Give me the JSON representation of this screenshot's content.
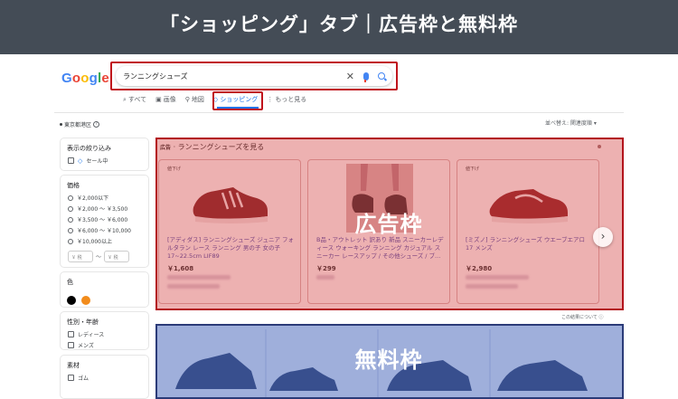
{
  "banner": {
    "title": "「ショッピング」タブ｜広告枠と無料枠"
  },
  "google": {
    "logo": [
      "G",
      "o",
      "o",
      "g",
      "l",
      "e"
    ]
  },
  "search": {
    "query": "ランニングシューズ",
    "clear_icon": "close-icon",
    "mic_icon": "mic-icon",
    "search_icon": "search-icon"
  },
  "tabs": [
    {
      "label": "すべて",
      "icon": "search-icon"
    },
    {
      "label": "画像",
      "icon": "image-icon"
    },
    {
      "label": "地図",
      "icon": "map-pin-icon"
    },
    {
      "label": "ショッピング",
      "icon": "tag-icon",
      "active": true
    },
    {
      "label": "もっと見る",
      "icon": "more-icon"
    }
  ],
  "location": {
    "text": "東京都港区"
  },
  "sort": {
    "label": "並べ替え: 関連度順"
  },
  "filters": {
    "refine": {
      "heading": "表示の絞り込み",
      "option": "セール中"
    },
    "price": {
      "heading": "価格",
      "options": [
        "￥2,000以下",
        "￥2,000 ～ ￥3,500",
        "￥3,500 ～ ￥6,000",
        "￥6,000 ～ ￥10,000",
        "￥10,000以上"
      ],
      "min_placeholder": "￥ 税",
      "max_placeholder": "￥ 税",
      "separator": "～"
    },
    "color": {
      "heading": "色",
      "swatches": [
        "#000000",
        "#f28c1c"
      ]
    },
    "gender": {
      "heading": "性別・年齢",
      "options": [
        "レディース",
        "メンズ"
      ]
    },
    "material": {
      "heading": "素材",
      "options": [
        "ゴム"
      ]
    }
  },
  "ads": {
    "header_label": "広告",
    "header_text": "· ランニングシューズを見る",
    "overlay_label": "広告枠",
    "products": [
      {
        "badge": "値下げ",
        "title": "[アディダス] ランニングシューズ ジュニア フォルタラン レース ランニング 男の子 女の子 17~22.5cm LIF89",
        "price": "￥1,608"
      },
      {
        "badge": "",
        "title": "B品・アウトレット 訳あり 新品 スニーカーレディース ウォーキング ランニング カジュアル スニーカー レースアップ / その他シューズ / ブ...",
        "price": "￥299"
      },
      {
        "badge": "値下げ",
        "title": "[ミズノ] ランニングシューズ ウエーブエアロ 17 メンズ",
        "price": "￥2,980"
      }
    ],
    "about": "この結果について ⓘ"
  },
  "free": {
    "overlay_label": "無料枠"
  },
  "colors": {
    "ad_red": "#b3141c",
    "free_blue": "#2b3b78",
    "banner_bg": "#444c56",
    "link_blue": "#1a73e8"
  }
}
